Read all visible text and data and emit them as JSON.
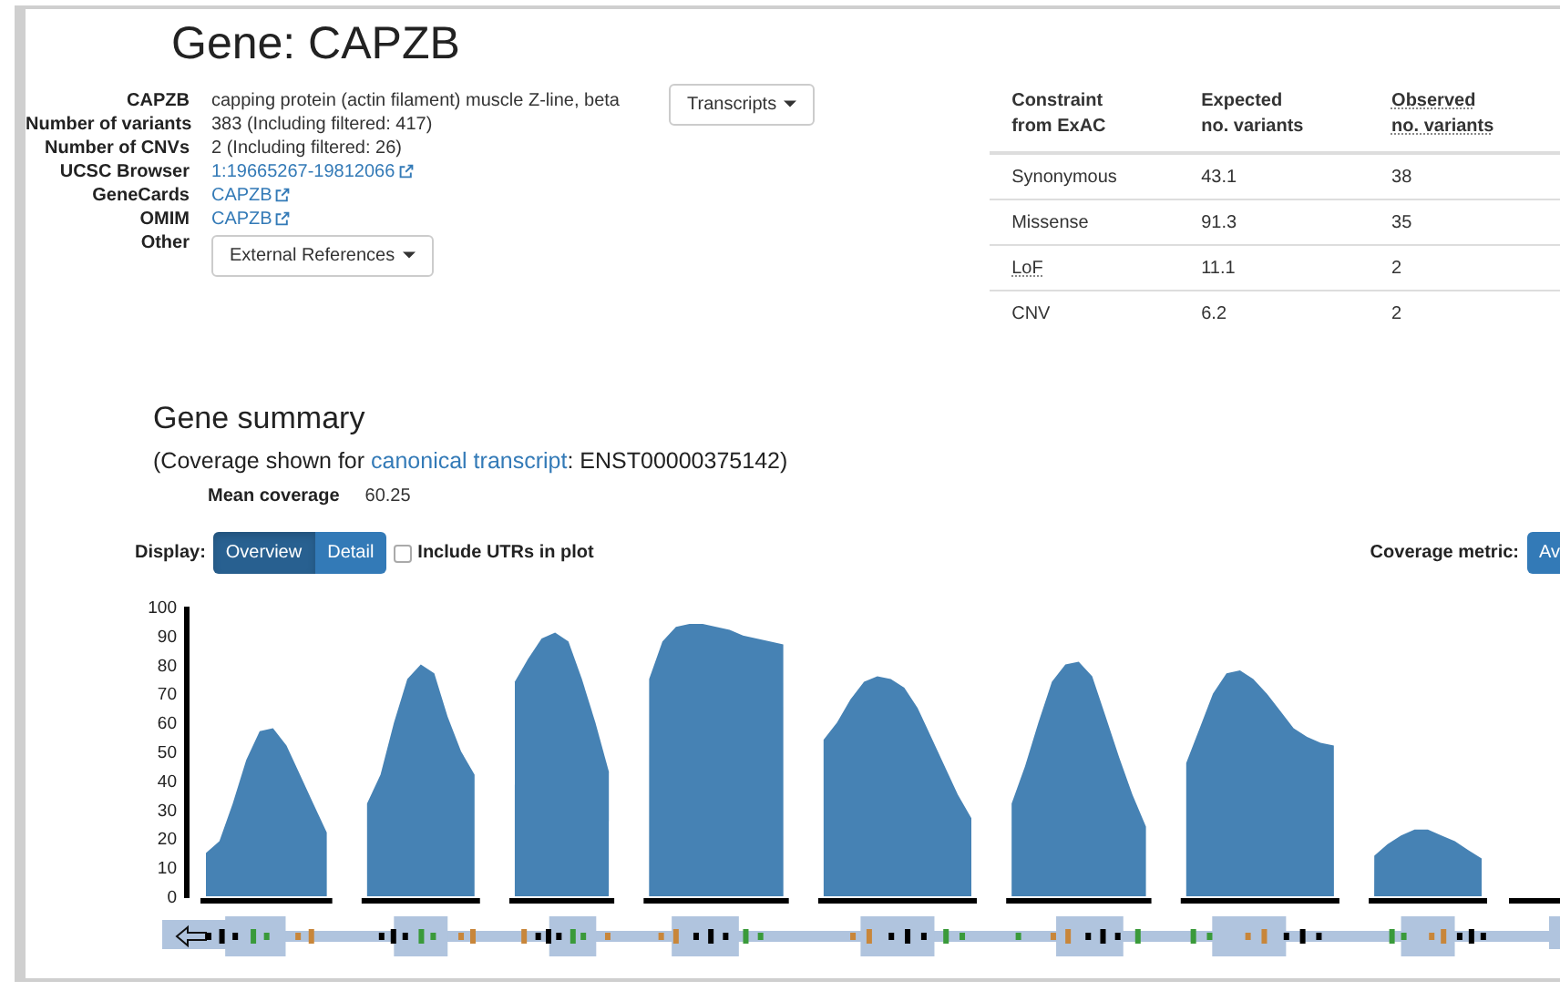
{
  "title": "Gene: CAPZB",
  "info": [
    {
      "label": "CAPZB",
      "value": "capping protein (actin filament) muscle Z-line, beta",
      "kind": "text"
    },
    {
      "label": "Number of variants",
      "value": "383 (Including filtered: 417)",
      "kind": "text"
    },
    {
      "label": "Number of CNVs",
      "value": "2 (Including filtered: 26)",
      "kind": "text"
    },
    {
      "label": "UCSC Browser",
      "value": "1:19665267-19812066",
      "kind": "link"
    },
    {
      "label": "GeneCards",
      "value": "CAPZB",
      "kind": "link"
    },
    {
      "label": "OMIM",
      "value": "CAPZB",
      "kind": "link"
    },
    {
      "label": "Other",
      "value": "External References",
      "kind": "dropdown"
    }
  ],
  "transcripts_button": "Transcripts",
  "constraint_table": {
    "columns": [
      [
        "Constraint",
        "from ExAC"
      ],
      [
        "Expected",
        "no. variants"
      ],
      [
        "Observed",
        "no. variants"
      ]
    ],
    "rows": [
      {
        "category": "Synonymous",
        "expected": "43.1",
        "observed": "38"
      },
      {
        "category": "Missense",
        "expected": "91.3",
        "observed": "35"
      },
      {
        "category": "LoF",
        "expected": "11.1",
        "observed": "2"
      },
      {
        "category": "CNV",
        "expected": "6.2",
        "observed": "2"
      }
    ]
  },
  "summary": {
    "title": "Gene summary",
    "note_prefix": "(Coverage shown for ",
    "note_link": "canonical transcript",
    "note_suffix": ": ENST00000375142)",
    "mean_label": "Mean coverage",
    "mean_value": "60.25"
  },
  "display": {
    "label": "Display:",
    "options": [
      {
        "label": "Overview",
        "selected": true
      },
      {
        "label": "Detail",
        "selected": false
      }
    ],
    "utr_checkbox": {
      "label": "Include UTRs in plot",
      "checked": false
    }
  },
  "coverage_metric": {
    "label": "Coverage metric:",
    "button": "Av"
  },
  "coverage_plot": {
    "y_axis_labels": [
      "100",
      "90",
      "80",
      "70",
      "60",
      "50",
      "40",
      "30",
      "20",
      "10",
      "0"
    ]
  }
}
